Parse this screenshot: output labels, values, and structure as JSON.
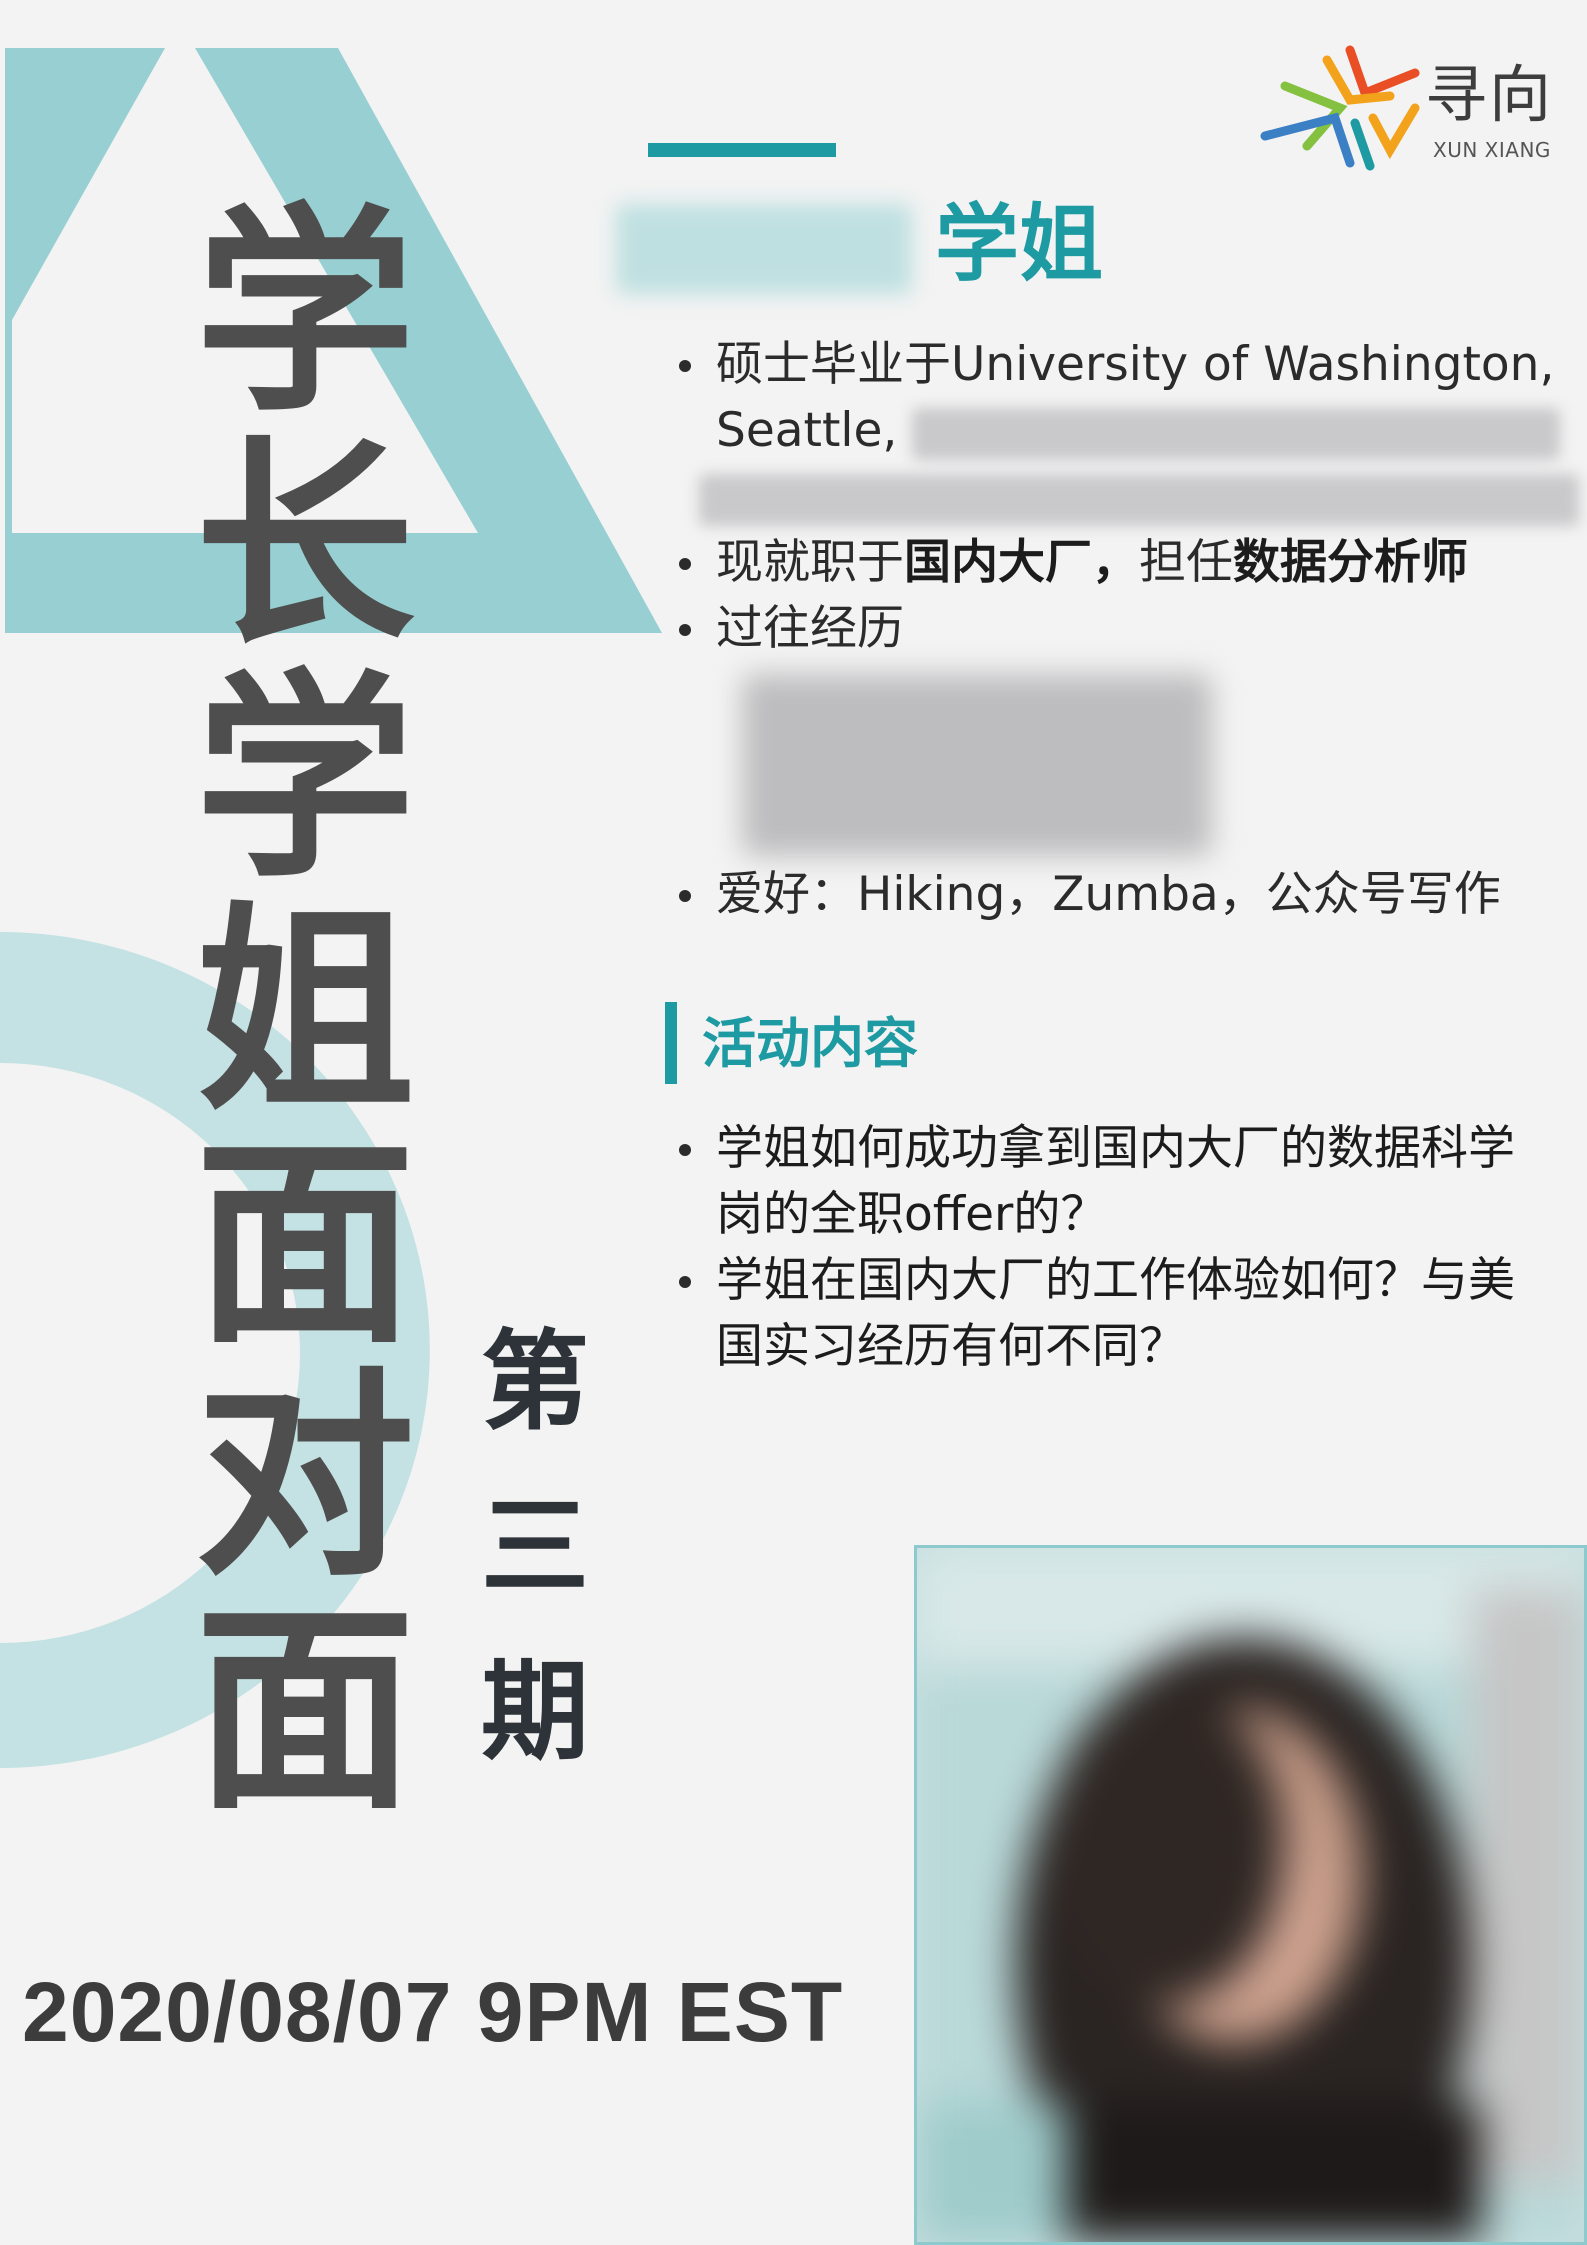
{
  "logo": {
    "name": "寻向",
    "sub": "XUN XIANG",
    "colors": [
      "#e94e24",
      "#f3a21b",
      "#84c140",
      "#3b7fc4",
      "#1e9aa3"
    ]
  },
  "profile": {
    "name_suffix": "学姐",
    "edu_line1": "硕士毕业于University of Washington,",
    "edu_line2": "Seattle,",
    "job_prefix": "现就职于",
    "job_company": "国内大厂，",
    "job_mid": "担任",
    "job_title": "数据分析师",
    "history_label": "过往经历",
    "hobbies": "爱好：Hiking，Zumba，公众号写作"
  },
  "activity": {
    "heading": "活动内容",
    "items": [
      "学姐如何成功拿到国内大厂的数据科学岗的全职offer的？",
      "学姐在国内大厂的工作体验如何？与美国实习经历有何不同？"
    ]
  },
  "title": {
    "chars": [
      "学",
      "长",
      "学",
      "姐",
      "面",
      "对",
      "面"
    ],
    "issue_chars": [
      "第",
      "三",
      "期"
    ]
  },
  "event": {
    "date": "2020/08/07 9PM EST"
  },
  "colors": {
    "accent": "#1e9aa3",
    "shape_teal": "#97cfd2",
    "shape_light": "#c4e2e3",
    "background": "#f3f3f3",
    "title_gray": "#4e4e4e"
  }
}
